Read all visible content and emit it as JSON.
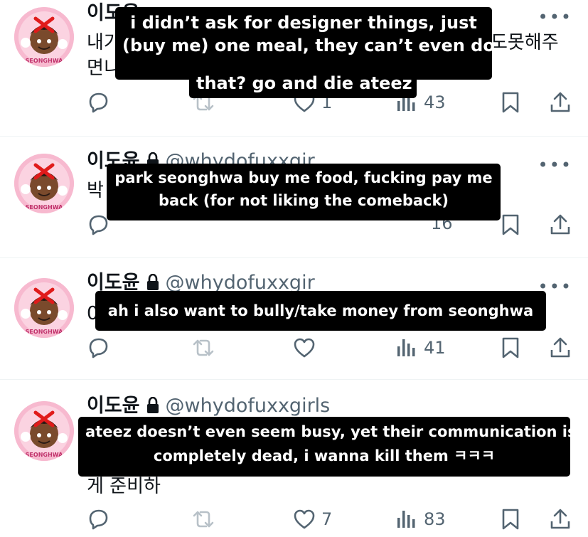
{
  "tweets": [
    {
      "name": "이도윤",
      "handle": "",
      "text_line1": "내가",
      "text_line1_right": "도못해주",
      "text_line2": "면니",
      "replies": "",
      "reposts": "",
      "likes": "1",
      "views": "43",
      "caption": [
        "i didn’t ask for designer things, just",
        "(buy me) one meal, they can’t even do",
        "that? go and die ateez"
      ]
    },
    {
      "name": "이도윤",
      "handle": "@whydofuxxgir",
      "text_line1": "박",
      "replies": "",
      "reposts": "",
      "likes": "",
      "views": "16",
      "caption": [
        "park seonghwa buy me food, fucking pay me",
        "back (for not liking the comeback)"
      ]
    },
    {
      "name": "이도윤",
      "handle": "@whydofuxxgir",
      "text_line1": "0",
      "replies": "",
      "reposts": "",
      "likes": "",
      "views": "41",
      "caption": [
        "ah i also want to bully/take money from seonghwa"
      ]
    },
    {
      "name": "이도윤",
      "handle": "@whydofuxxgirls",
      "text_line1": "게 준비하",
      "replies": "",
      "reposts": "",
      "likes": "7",
      "views": "83",
      "caption": [
        "ateez doesn’t even seem busy, yet their communication is",
        "completely dead, i wanna kill them ㅋㅋㅋ"
      ]
    }
  ],
  "avatar_text": "SEONGHWA",
  "more_label": "•••",
  "icons": [
    "reply-icon",
    "repost-icon",
    "like-icon",
    "views-icon",
    "bookmark-icon",
    "share-icon",
    "lock-icon"
  ],
  "colors": {
    "muted": "#536471",
    "caption_bg": "#000000",
    "avatar_bg": "#f7b9cf",
    "divider": "#eff3f4"
  }
}
